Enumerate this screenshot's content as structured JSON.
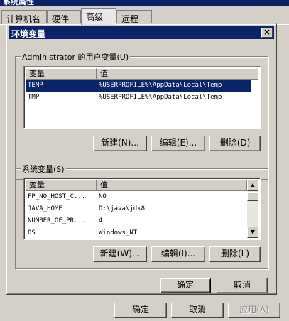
{
  "background_window": {
    "title": "系统属性",
    "tabs": [
      "计算机名",
      "硬件",
      "高级",
      "远程"
    ],
    "active_tab": 2,
    "buttons": {
      "ok": "确定",
      "cancel": "取消",
      "apply": "应用(A)"
    }
  },
  "dialog": {
    "title": "环境变量",
    "close_glyph": "×",
    "user_vars": {
      "label": "Administrator 的用户变量(U)",
      "headers": [
        "变量",
        "值"
      ],
      "rows": [
        {
          "name": "TEMP",
          "value": "%USERPROFILE%\\AppData\\Local\\Temp"
        },
        {
          "name": "TMP",
          "value": "%USERPROFILE%\\AppData\\Local\\Temp"
        }
      ],
      "selected_row": 0,
      "buttons": {
        "new": "新建(N)...",
        "edit": "编辑(E)...",
        "delete": "删除(D)"
      }
    },
    "system_vars": {
      "label": "系统变量(S)",
      "headers": [
        "变量",
        "值"
      ],
      "rows": [
        {
          "name": "FP_NO_HOST_C...",
          "value": "NO"
        },
        {
          "name": "JAVA_HOME",
          "value": "D:\\java\\jdk8"
        },
        {
          "name": "NUMBER_OF_PR...",
          "value": "4"
        },
        {
          "name": "OS",
          "value": "Windows_NT"
        }
      ],
      "buttons": {
        "new": "新建(W)...",
        "edit": "编辑(I)...",
        "delete": "删除(L)"
      },
      "scrollbar": {
        "up_glyph": "▲",
        "down_glyph": "▼"
      }
    },
    "buttons": {
      "ok": "确定",
      "cancel": "取消"
    }
  }
}
